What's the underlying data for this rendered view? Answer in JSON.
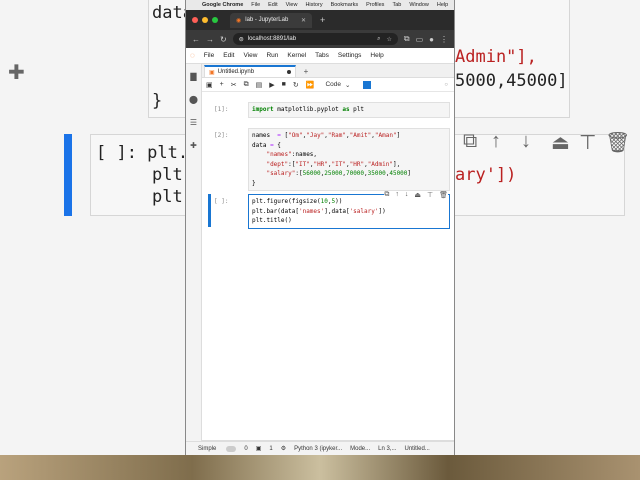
{
  "macbar": {
    "app": "Google Chrome",
    "menus": [
      "File",
      "Edit",
      "View",
      "History",
      "Bookmarks",
      "Profiles",
      "Tab",
      "Window",
      "Help"
    ]
  },
  "browser": {
    "tab_title": "lab - JupyterLab",
    "url": "localhost:8891/lab"
  },
  "jupyter": {
    "menus": [
      "File",
      "Edit",
      "View",
      "Run",
      "Kernel",
      "Tabs",
      "Settings",
      "Help"
    ],
    "notebook_tab": "Untitled.ipynb",
    "cell_type": "Code",
    "cells": [
      {
        "prompt": "[1]:",
        "lines": [
          "import matplotlib.pyplot as plt"
        ]
      },
      {
        "prompt": "[2]:",
        "lines": [
          "names  = [\"Om\",\"Jay\",\"Ram\",\"Amit\",\"Aman\"]",
          "data = {",
          "    \"names\":names,",
          "    \"dept\":[\"IT\",\"HR\",\"IT\",\"HR\",\"Admin\"],",
          "    \"salary\":[56000,25000,70000,35000,45000]",
          "}"
        ]
      },
      {
        "prompt": "[ ]:",
        "lines": [
          "plt.figure(figsize(10,5))",
          "plt.bar(data['names'],data['salary'])",
          "plt.title()"
        ]
      }
    ],
    "status": {
      "mode_label": "Simple",
      "count0": "0",
      "count1": "1",
      "kernel": "Python 3 (ipyker...",
      "mode": "Mode...",
      "position": "Ln 3,...",
      "file": "Untitled..."
    }
  },
  "background": {
    "left_top": "data",
    "left_bottom": "}",
    "left_cell_lines": [
      "[ ]: plt.",
      "plt.",
      "plt."
    ],
    "right_line1": "Admin\"],",
    "right_line2": "5000,45000]",
    "right_cell": "ary'])"
  },
  "colors": {
    "accent": "#1976d2",
    "jupyter_orange": "#f37626"
  }
}
